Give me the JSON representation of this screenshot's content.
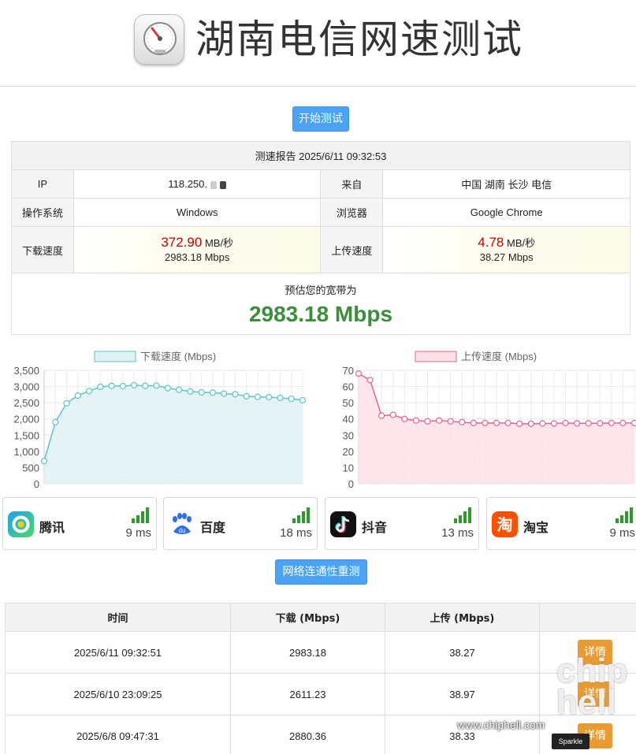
{
  "header": {
    "title": "湖南电信网速测试",
    "logo_icon": "speedometer-icon"
  },
  "buttons": {
    "start": "开始测试",
    "retest": "网络连通性重测"
  },
  "report": {
    "title": "测速报告 2025/6/11 09:32:53",
    "ip_label": "IP",
    "ip_value": "118.250.",
    "from_label": "来自",
    "from_value": "中国 湖南 长沙 电信",
    "os_label": "操作系统",
    "os_value": "Windows",
    "browser_label": "浏览器",
    "browser_value": "Google Chrome",
    "download_label": "下载速度",
    "download_mbs": "372.90",
    "download_unit": "MB/秒",
    "download_mbps": "2983.18 Mbps",
    "upload_label": "上传速度",
    "upload_mbs": "4.78",
    "upload_unit": "MB/秒",
    "upload_mbps": "38.27 Mbps",
    "bandwidth_label": "预估您的宽带为",
    "bandwidth_value": "2983.18 Mbps"
  },
  "chart_data": [
    {
      "type": "line",
      "legend": "下载速度 (Mbps)",
      "color": "#5cc5c5",
      "fill": "#dff2f3",
      "ylim": [
        0,
        3500
      ],
      "yticks": [
        "3,500",
        "3,000",
        "2,500",
        "2,000",
        "1,500",
        "1,000",
        "500",
        "0"
      ],
      "values": [
        700,
        1900,
        2480,
        2720,
        2860,
        2990,
        3020,
        3010,
        3040,
        3020,
        3030,
        2950,
        2900,
        2850,
        2820,
        2810,
        2780,
        2760,
        2700,
        2680,
        2670,
        2650,
        2620,
        2580
      ]
    },
    {
      "type": "line",
      "legend": "上传速度 (Mbps)",
      "color": "#e8658b",
      "fill": "#fde0e7",
      "ylim": [
        0,
        70
      ],
      "yticks": [
        "70",
        "60",
        "50",
        "40",
        "30",
        "20",
        "10",
        "0"
      ],
      "values": [
        68,
        64,
        42,
        42.5,
        40,
        39,
        38.5,
        39,
        38.5,
        38,
        37.5,
        37.5,
        37.5,
        37.5,
        37,
        37,
        37.2,
        37.2,
        37.5,
        37.3,
        37.3,
        37.3,
        37.5,
        37.5,
        37.5
      ]
    }
  ],
  "sites": [
    {
      "name": "腾讯",
      "latency": "9 ms",
      "icon": "tencent-icon"
    },
    {
      "name": "百度",
      "latency": "18 ms",
      "icon": "baidu-icon"
    },
    {
      "name": "抖音",
      "latency": "13 ms",
      "icon": "douyin-icon"
    },
    {
      "name": "淘宝",
      "latency": "9 ms",
      "icon": "taobao-icon"
    }
  ],
  "history": {
    "headers": [
      "时间",
      "下载 (Mbps)",
      "上传 (Mbps)",
      ""
    ],
    "rows": [
      {
        "time": "2025/6/11 09:32:51",
        "down": "2983.18",
        "up": "38.27",
        "action": "详情"
      },
      {
        "time": "2025/6/10 23:09:25",
        "down": "2611.23",
        "up": "38.97",
        "action": "详情"
      },
      {
        "time": "2025/6/8 09:47:31",
        "down": "2880.36",
        "up": "38.33",
        "action": "详情"
      }
    ]
  },
  "watermark": {
    "site": "www.chiphell.com",
    "logo": "chip hell",
    "tag": "Sparkle"
  }
}
